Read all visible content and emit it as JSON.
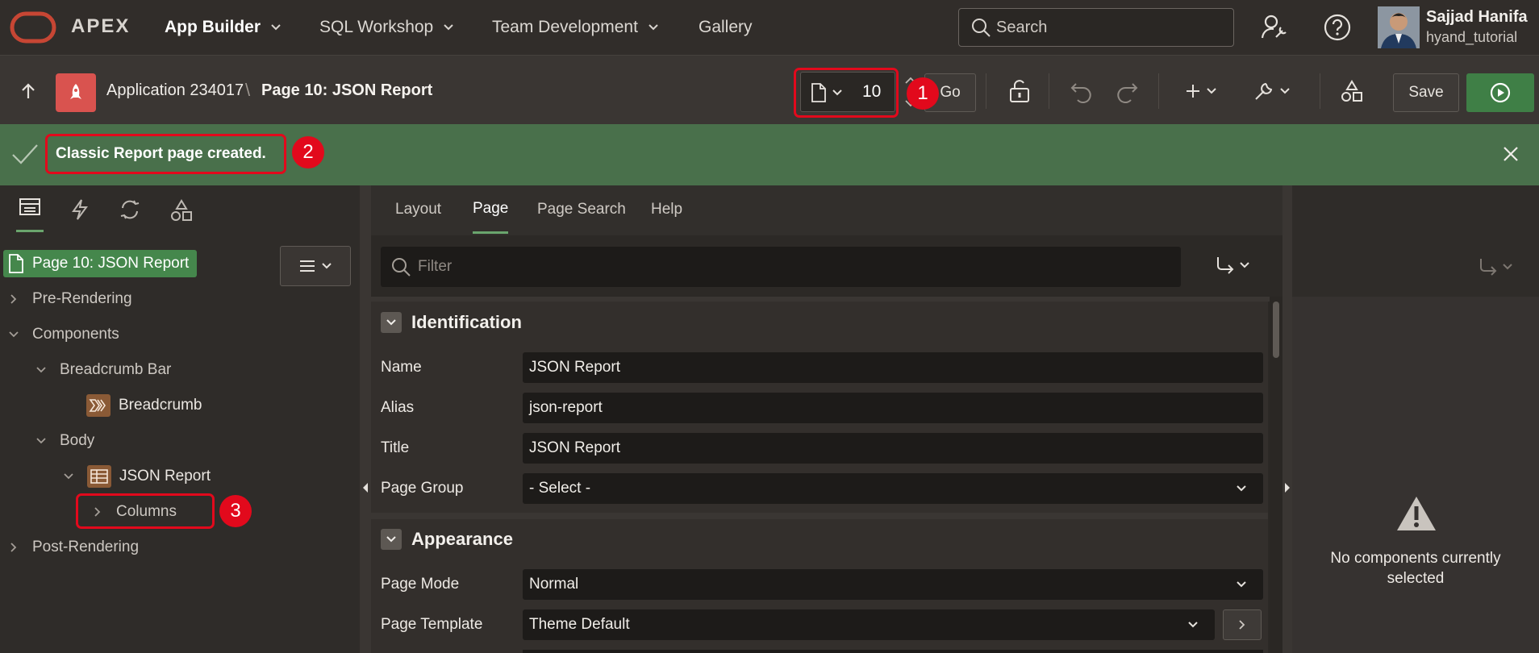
{
  "topnav": {
    "brand": "APEX",
    "menu": [
      {
        "label": "App Builder"
      },
      {
        "label": "SQL Workshop"
      },
      {
        "label": "Team Development"
      },
      {
        "label": "Gallery"
      }
    ],
    "search_placeholder": "Search",
    "user": {
      "name": "Sajjad Hanifa",
      "workspace": "hyand_tutorial"
    }
  },
  "toolbar": {
    "breadcrumb_app": "Application 234017",
    "breadcrumb_separator": "\\",
    "breadcrumb_page": "Page 10: JSON Report",
    "page_number": "10",
    "go_label": "Go",
    "save_label": "Save"
  },
  "banner": {
    "message": "Classic Report page created.",
    "color": "#49704b"
  },
  "left_panel": {
    "root_label": "Page 10: JSON Report",
    "tree": [
      {
        "label": "Pre-Rendering"
      },
      {
        "label": "Components"
      },
      {
        "label": "Breadcrumb Bar"
      },
      {
        "label": "Breadcrumb"
      },
      {
        "label": "Body"
      },
      {
        "label": "JSON Report"
      },
      {
        "label": "Columns"
      },
      {
        "label": "Post-Rendering"
      }
    ]
  },
  "center_panel": {
    "tabs": [
      {
        "label": "Layout"
      },
      {
        "label": "Page"
      },
      {
        "label": "Page Search"
      },
      {
        "label": "Help"
      }
    ],
    "filter_placeholder": "Filter",
    "sections": {
      "identification": {
        "title": "Identification",
        "fields": [
          {
            "label": "Name",
            "value": "JSON Report"
          },
          {
            "label": "Alias",
            "value": "json-report"
          },
          {
            "label": "Title",
            "value": "JSON Report"
          },
          {
            "label": "Page Group",
            "value": "- Select -"
          }
        ]
      },
      "appearance": {
        "title": "Appearance",
        "fields": [
          {
            "label": "Page Mode",
            "value": "Normal"
          },
          {
            "label": "Page Template",
            "value": "Theme Default"
          }
        ]
      }
    }
  },
  "right_panel": {
    "message": "No components currently selected"
  },
  "annotations": [
    {
      "number": "1"
    },
    {
      "number": "2"
    },
    {
      "number": "3"
    }
  ],
  "colors": {
    "accent_green": "#3f7f46",
    "annotation_red": "#e2091c",
    "oracle_red": "#c74634"
  }
}
